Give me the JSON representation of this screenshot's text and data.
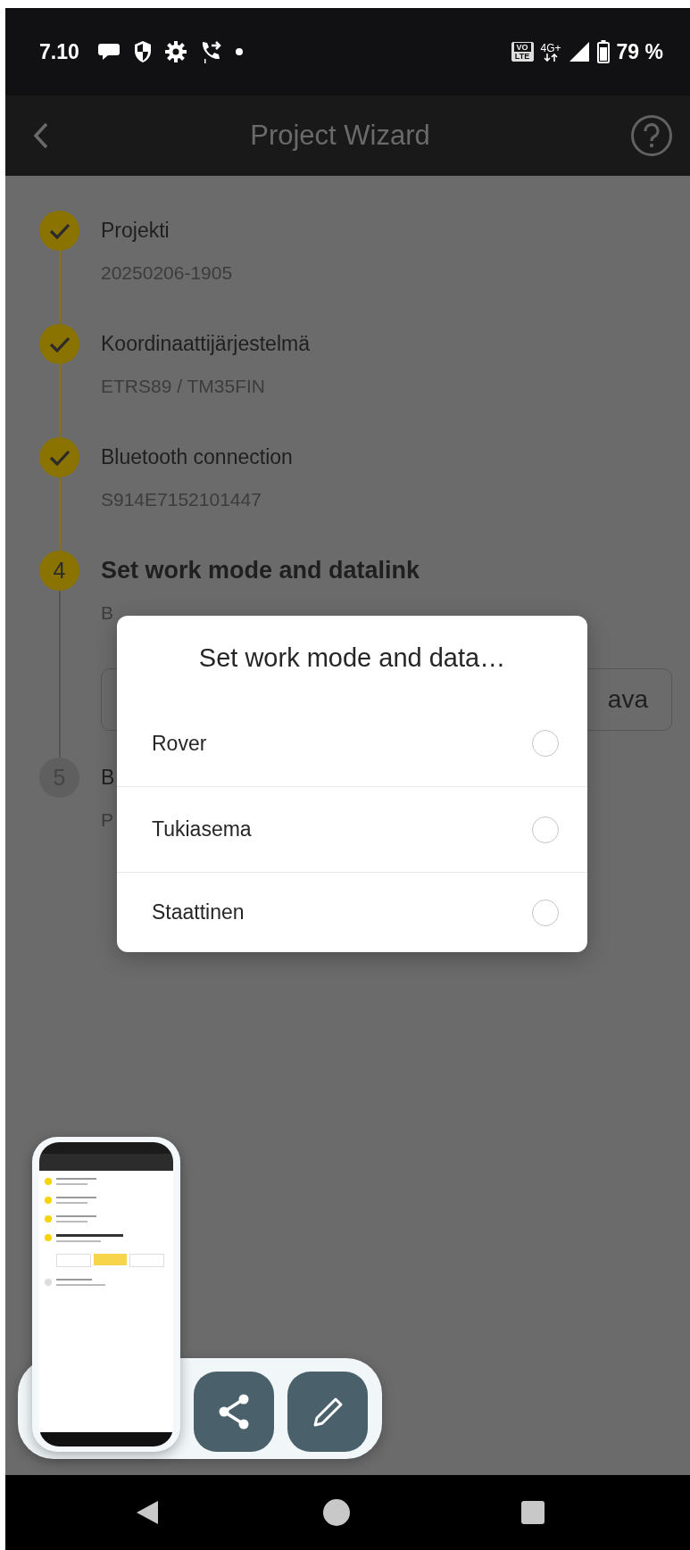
{
  "status_bar": {
    "time": "7.10",
    "volte_top": "VO",
    "volte_bottom": "LTE",
    "network": "4G+",
    "battery": "79 %"
  },
  "app_bar": {
    "title": "Project Wizard"
  },
  "steps": [
    {
      "kind": "done",
      "title": "Projekti",
      "subtitle": "20250206-1905"
    },
    {
      "kind": "done",
      "title": "Koordinaattijärjestelmä",
      "subtitle": "ETRS89 / TM35FIN"
    },
    {
      "kind": "done",
      "title": "Bluetooth connection",
      "subtitle": "S914E7152101447"
    },
    {
      "kind": "current",
      "number": "4",
      "title": "Set work mode and datalink",
      "subtitle": "B",
      "buttons": [
        {
          "kind": "covered"
        },
        {
          "kind": "outline",
          "label": "ava"
        }
      ]
    },
    {
      "kind": "pending",
      "number": "5",
      "title": "B",
      "subtitle": "P"
    }
  ],
  "dialog": {
    "title": "Set work mode and data…",
    "options": [
      {
        "label": "Rover",
        "selected": false
      },
      {
        "label": "Tukiasema",
        "selected": false
      },
      {
        "label": "Staattinen",
        "selected": false
      }
    ]
  },
  "screenshot_toolbar": {
    "actions": [
      {
        "kind": "share"
      },
      {
        "kind": "edit"
      }
    ]
  }
}
